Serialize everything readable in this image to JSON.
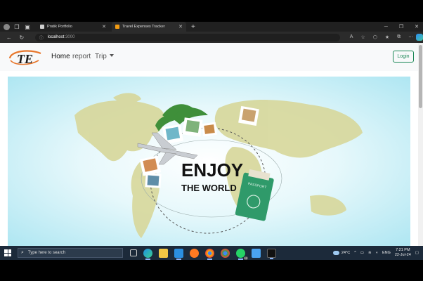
{
  "browser": {
    "tabs": [
      {
        "title": "Pratik Portfolio",
        "favicon_color": "#cfcfcf"
      },
      {
        "title": "Travel Expenses Tracker",
        "favicon_color": "#f39c12"
      }
    ],
    "address": {
      "host": "localhost",
      "port": ":3000"
    }
  },
  "navbar": {
    "logo_text": "TE",
    "home": "Home",
    "report": "report",
    "trip": "Trip",
    "login": "Login"
  },
  "hero": {
    "line1": "ENJOY",
    "line2": "THE WORLD",
    "passport_label": "PASSPORT"
  },
  "taskbar": {
    "search_placeholder": "Type here to search",
    "whatsapp_badge": "22",
    "temperature": "24°C",
    "language": "ENG",
    "time": "7:21 PM",
    "date": "22-Jul-24"
  }
}
